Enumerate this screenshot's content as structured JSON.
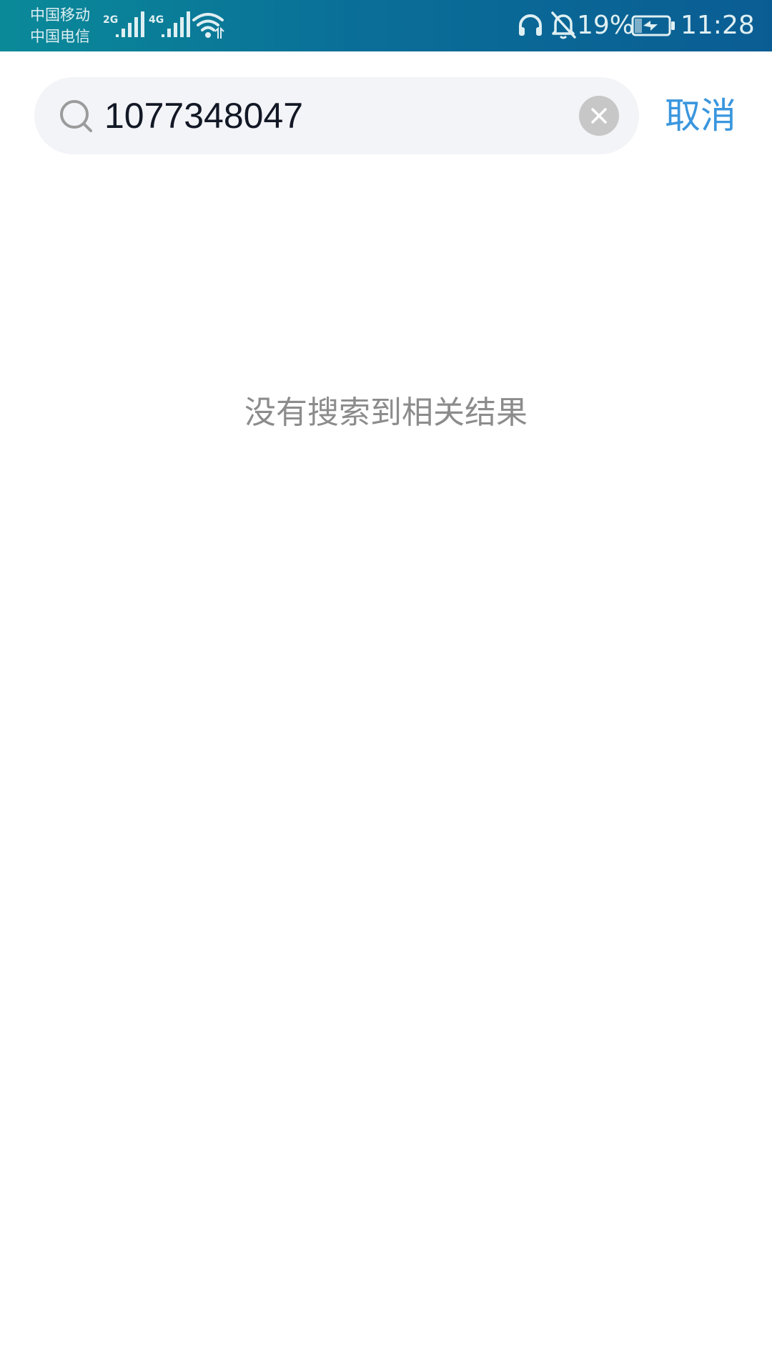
{
  "status_bar": {
    "carrier_1": "中国移动",
    "carrier_2": "中国电信",
    "sim1_network": "2G",
    "sim2_network": "4G",
    "battery_percent": "19%",
    "time": "11:28",
    "icons": [
      "signal-icon",
      "wifi-icon",
      "headset-icon",
      "bell-off-icon",
      "battery-charging-icon"
    ]
  },
  "search": {
    "query": "1077348047",
    "cancel_label": "取消"
  },
  "results": {
    "empty_message": "没有搜索到相关结果"
  },
  "colors": {
    "accent": "#3a96de",
    "status_bar": "#0a6f98",
    "search_bg": "#f3f4f8",
    "empty_text": "#8c8c8c"
  }
}
